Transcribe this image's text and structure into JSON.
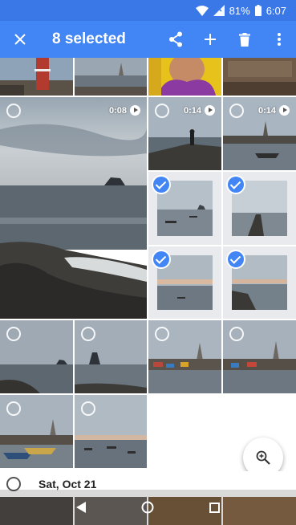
{
  "status": {
    "battery": "81%",
    "time": "6:07"
  },
  "app_bar": {
    "title": "8 selected"
  },
  "videos": [
    {
      "duration": "0:08"
    },
    {
      "duration": "0:14"
    },
    {
      "duration": "0:14"
    }
  ],
  "date_header": {
    "label": "Sat, Oct 21"
  },
  "colors": {
    "accent": "#4285f4",
    "status_bar": "#3b78e7"
  },
  "icons": [
    "close-icon",
    "share-icon",
    "add-icon",
    "trash-icon",
    "more-icon",
    "zoom-icon",
    "check-icon",
    "play-icon",
    "back-icon",
    "home-icon",
    "recents-icon"
  ]
}
